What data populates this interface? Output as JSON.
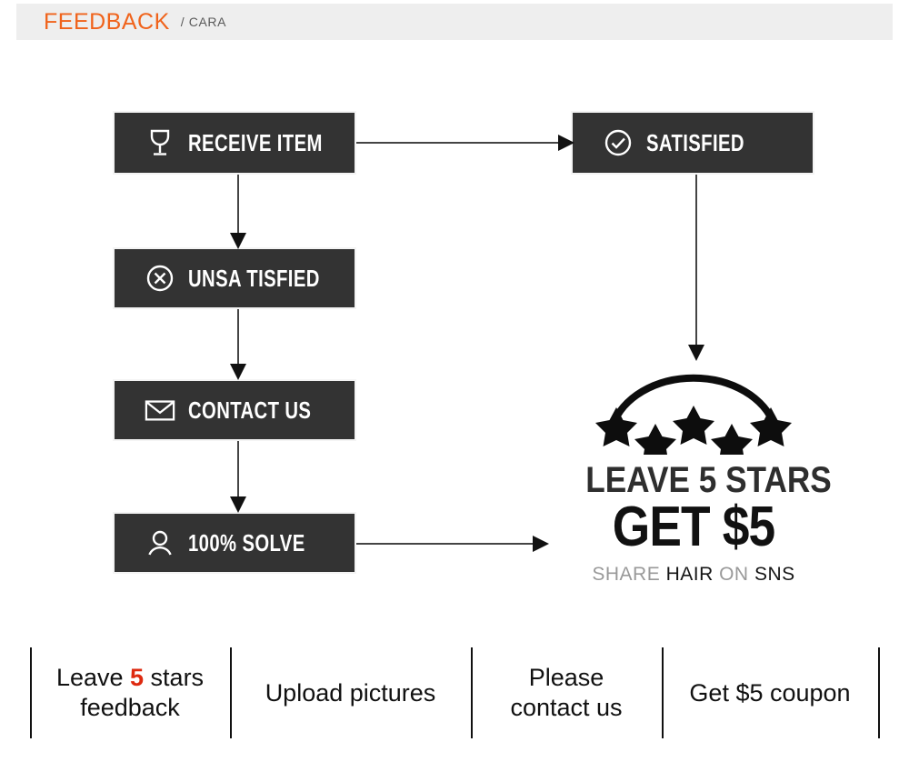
{
  "header": {
    "title": "FEEDBACK",
    "subtitle": "/ CARA",
    "accent_color": "#f0631b",
    "subtitle_color": "#5a5a5a",
    "bar_color": "#eeeeee"
  },
  "flow": {
    "box_fill": "#333333",
    "box_text_color": "#ffffff",
    "steps": [
      {
        "id": "receive",
        "label": "RECEIVE ITEM",
        "icon": "wine-glass-icon"
      },
      {
        "id": "unsatisfied",
        "label": "UNSA TISFIED",
        "icon": "circle-x-icon"
      },
      {
        "id": "contact",
        "label": "CONTACT US",
        "icon": "envelope-icon"
      },
      {
        "id": "solve",
        "label": "100% SOLVE",
        "icon": "person-icon"
      },
      {
        "id": "satisfied",
        "label": "SATISFIED",
        "icon": "circle-check-icon"
      }
    ],
    "connectors": [
      {
        "id": "receive-to-satisfied",
        "direction": "right"
      },
      {
        "id": "receive-to-unsatisfied",
        "direction": "down"
      },
      {
        "id": "unsatisfied-to-contact",
        "direction": "down"
      },
      {
        "id": "contact-to-solve",
        "direction": "down"
      },
      {
        "id": "satisfied-to-promo",
        "direction": "down"
      },
      {
        "id": "solve-to-promo",
        "direction": "right"
      }
    ]
  },
  "promo": {
    "stars_count": 5,
    "stars_icon": "five-stars-arc-icon",
    "line1": "LEAVE 5 STARS",
    "line2": "GET $5",
    "line3_parts": [
      {
        "text": "SHARE",
        "style": "dim"
      },
      {
        "text": "HAIR",
        "style": "bold"
      },
      {
        "text": "ON",
        "style": "dim"
      },
      {
        "text": "SNS",
        "style": "bold"
      }
    ]
  },
  "bottom": {
    "highlight_color": "#de2a10",
    "cells": [
      {
        "id": "leave-stars",
        "pre": "Leave ",
        "hl": "5",
        "post": " stars",
        "line2": "feedback"
      },
      {
        "id": "upload",
        "pre": "Upload pictures",
        "hl": "",
        "post": "",
        "line2": ""
      },
      {
        "id": "contact",
        "pre": "Please",
        "hl": "",
        "post": "",
        "line2": "contact us"
      },
      {
        "id": "coupon",
        "pre": "Get $5 coupon",
        "hl": "",
        "post": "",
        "line2": ""
      }
    ]
  }
}
